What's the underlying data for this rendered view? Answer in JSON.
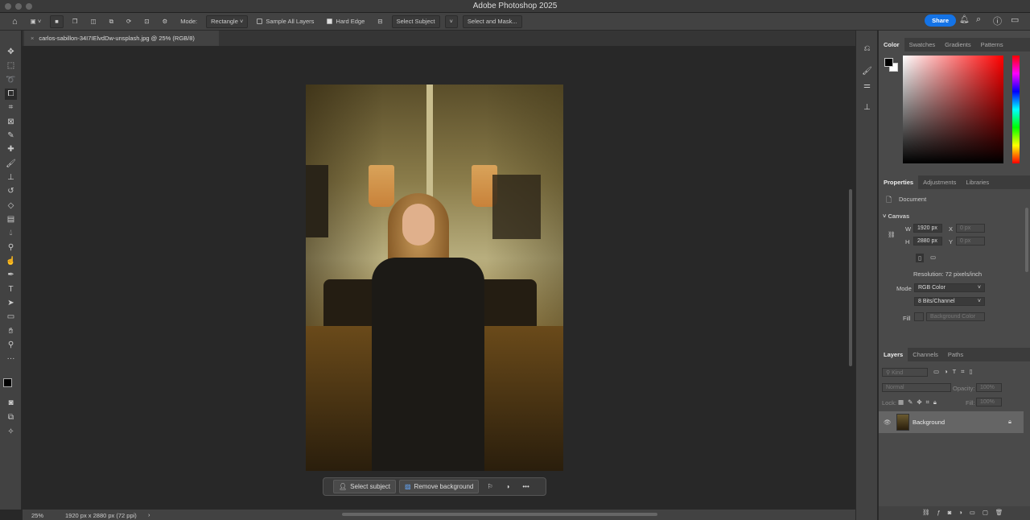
{
  "app": {
    "title": "Adobe Photoshop 2025"
  },
  "options": {
    "mode_label": "Mode:",
    "mode_value": "Rectangle",
    "sample_all_layers": "Sample All Layers",
    "sample_checked": false,
    "hard_edge": "Hard Edge",
    "hard_checked": true,
    "select_subject": "Select Subject",
    "select_and_mask": "Select and Mask...",
    "share": "Share"
  },
  "document": {
    "tab_title": "carlos-sabillon-34I7IElvdDw-unsplash.jpg @ 25% (RGB/8)",
    "close": "×"
  },
  "context_bar": {
    "select_subject": "Select subject",
    "remove_background": "Remove background",
    "more": "•••"
  },
  "status": {
    "zoom": "25%",
    "info": "1920 px x 2880 px (72 ppi)",
    "arrow": "›"
  },
  "color_panel": {
    "tabs": [
      "Color",
      "Swatches",
      "Gradients",
      "Patterns"
    ]
  },
  "properties": {
    "tabs": [
      "Properties",
      "Adjustments",
      "Libraries"
    ],
    "doc_label": "Document",
    "section": "Canvas",
    "w_label": "W",
    "w": "1920 px",
    "h_label": "H",
    "h": "2880 px",
    "x_label": "X",
    "x": "0 px",
    "y_label": "Y",
    "y": "0 px",
    "resolution": "Resolution: 72 pixels/inch",
    "mode_label": "Mode",
    "mode": "RGB Color",
    "depth": "8 Bits/Channel",
    "fill_label": "Fill",
    "fill": "Background Color"
  },
  "layers": {
    "tabs": [
      "Layers",
      "Channels",
      "Paths"
    ],
    "kind": "Kind",
    "blend": "Normal",
    "opacity_label": "Opacity:",
    "opacity": "100%",
    "lock_label": "Lock:",
    "fill_label": "Fill:",
    "fill": "100%",
    "items": [
      {
        "name": "Background",
        "visible": true,
        "locked": true
      }
    ]
  },
  "colors": {
    "accent": "#1473e6",
    "canvas": "#282828",
    "panel": "#4a4a4a"
  }
}
